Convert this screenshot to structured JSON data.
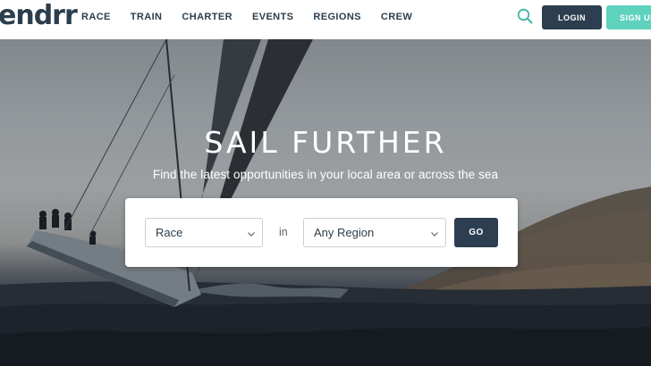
{
  "header": {
    "logo_text": "endrr",
    "nav": [
      {
        "label": "RACE"
      },
      {
        "label": "TRAIN"
      },
      {
        "label": "CHARTER"
      },
      {
        "label": "EVENTS"
      },
      {
        "label": "REGIONS"
      },
      {
        "label": "CREW"
      }
    ],
    "login_label": "LOGIN",
    "signup_label": "SIGN UP"
  },
  "hero": {
    "title": "SAIL FURTHER",
    "subtitle": "Find the latest opportunities in your local area or across the sea"
  },
  "search": {
    "type_selected": "Race",
    "in_label": "in",
    "region_selected": "Any Region",
    "go_label": "GO"
  },
  "colors": {
    "navy": "#2d3e50",
    "accent_teal": "#5ed2bd",
    "search_icon": "#3fb8a3",
    "text_dark": "#2c3e4c"
  },
  "icons": {
    "search": "search-icon",
    "chevron": "chevron-down-icon"
  }
}
